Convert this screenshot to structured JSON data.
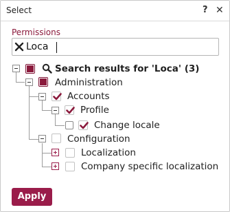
{
  "dialog": {
    "title": "Select",
    "help_label": "?",
    "close_label": "✕"
  },
  "permissions": {
    "label": "Permissions",
    "search_value": "Loca"
  },
  "tree": {
    "root_label": "Search results for 'Loca' (3)",
    "administration": "Administration",
    "accounts": "Accounts",
    "profile": "Profile",
    "change_locale": "Change locale",
    "configuration": "Configuration",
    "localization": "Localization",
    "company_localization": "Company specific localization"
  },
  "footer": {
    "apply_label": "Apply"
  },
  "colors": {
    "accent": "#9a1c4a",
    "label": "#8b1a3c"
  }
}
